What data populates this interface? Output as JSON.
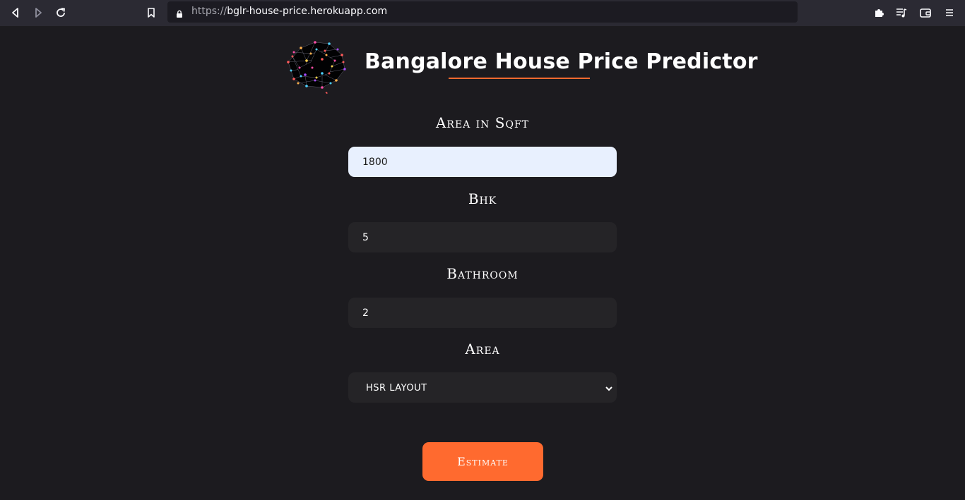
{
  "browser": {
    "url_scheme": "https://",
    "url_host": "bglr-house-price.herokuapp.com",
    "icons": [
      "back-icon",
      "forward-icon",
      "reload-icon",
      "bookmark-icon",
      "lock-icon",
      "extensions-icon",
      "media-icon",
      "wallet-icon",
      "menu-icon"
    ]
  },
  "header": {
    "title": "Bangalore House Price Predictor",
    "logo": "brain-network-logo"
  },
  "form": {
    "sqft_label": "Area in Sqft",
    "sqft_value": "1800",
    "bhk_label": "Bhk",
    "bhk_value": "5",
    "bath_label": "Bathroom",
    "bath_value": "2",
    "area_label": "Area",
    "area_selected": "HSR LAYOUT",
    "submit_label": "Estimate"
  },
  "colors": {
    "background": "#1c1b1f",
    "accent": "#ff6a2f",
    "input_bg": "#252427",
    "input_active_bg": "#e8f0fe"
  }
}
